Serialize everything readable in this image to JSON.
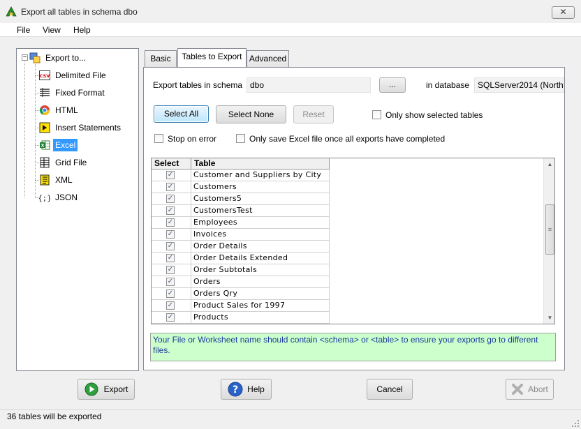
{
  "window": {
    "title": "Export all tables  in schema dbo",
    "close_label": "✕"
  },
  "menu": [
    "File",
    "View",
    "Help"
  ],
  "tree": {
    "root": "Export to...",
    "items": [
      {
        "label": "Delimited File",
        "icon": "csv-icon"
      },
      {
        "label": "Fixed Format",
        "icon": "fixed-format-icon"
      },
      {
        "label": "HTML",
        "icon": "html-icon"
      },
      {
        "label": "Insert Statements",
        "icon": "insert-statements-icon"
      },
      {
        "label": "Excel",
        "icon": "excel-icon",
        "selected": true
      },
      {
        "label": "Grid File",
        "icon": "grid-file-icon"
      },
      {
        "label": "XML",
        "icon": "xml-icon"
      },
      {
        "label": "JSON",
        "icon": "json-icon"
      }
    ]
  },
  "tabs": [
    {
      "label": "Basic",
      "active": false
    },
    {
      "label": "Tables to Export",
      "active": true
    },
    {
      "label": "Advanced",
      "active": false
    }
  ],
  "schema": {
    "label": "Export tables in schema",
    "value": "dbo",
    "browse_label": "...",
    "db_label": "in database",
    "db_value": "SQLServer2014 (Northw"
  },
  "buttons": {
    "select_all": "Select All",
    "select_none": "Select None",
    "reset": "Reset"
  },
  "options": {
    "only_selected": "Only show selected tables",
    "stop_on_error": "Stop on error",
    "save_once": "Only save Excel file once all exports have completed"
  },
  "grid": {
    "col_select": "Select",
    "col_table": "Table",
    "rows": [
      "Customer and Suppliers by City",
      "Customers",
      "Customers5",
      "CustomersTest",
      "Employees",
      "Invoices",
      "Order Details",
      "Order Details Extended",
      "Order Subtotals",
      "Orders",
      "Orders Qry",
      "Product Sales for 1997",
      "Products"
    ]
  },
  "hint": "Your File or Worksheet name should contain <schema> or <table> to ensure your exports go to different files.",
  "footer": {
    "export": "Export",
    "help": "Help",
    "cancel": "Cancel",
    "abort": "Abort"
  },
  "status": "36 tables will be exported"
}
